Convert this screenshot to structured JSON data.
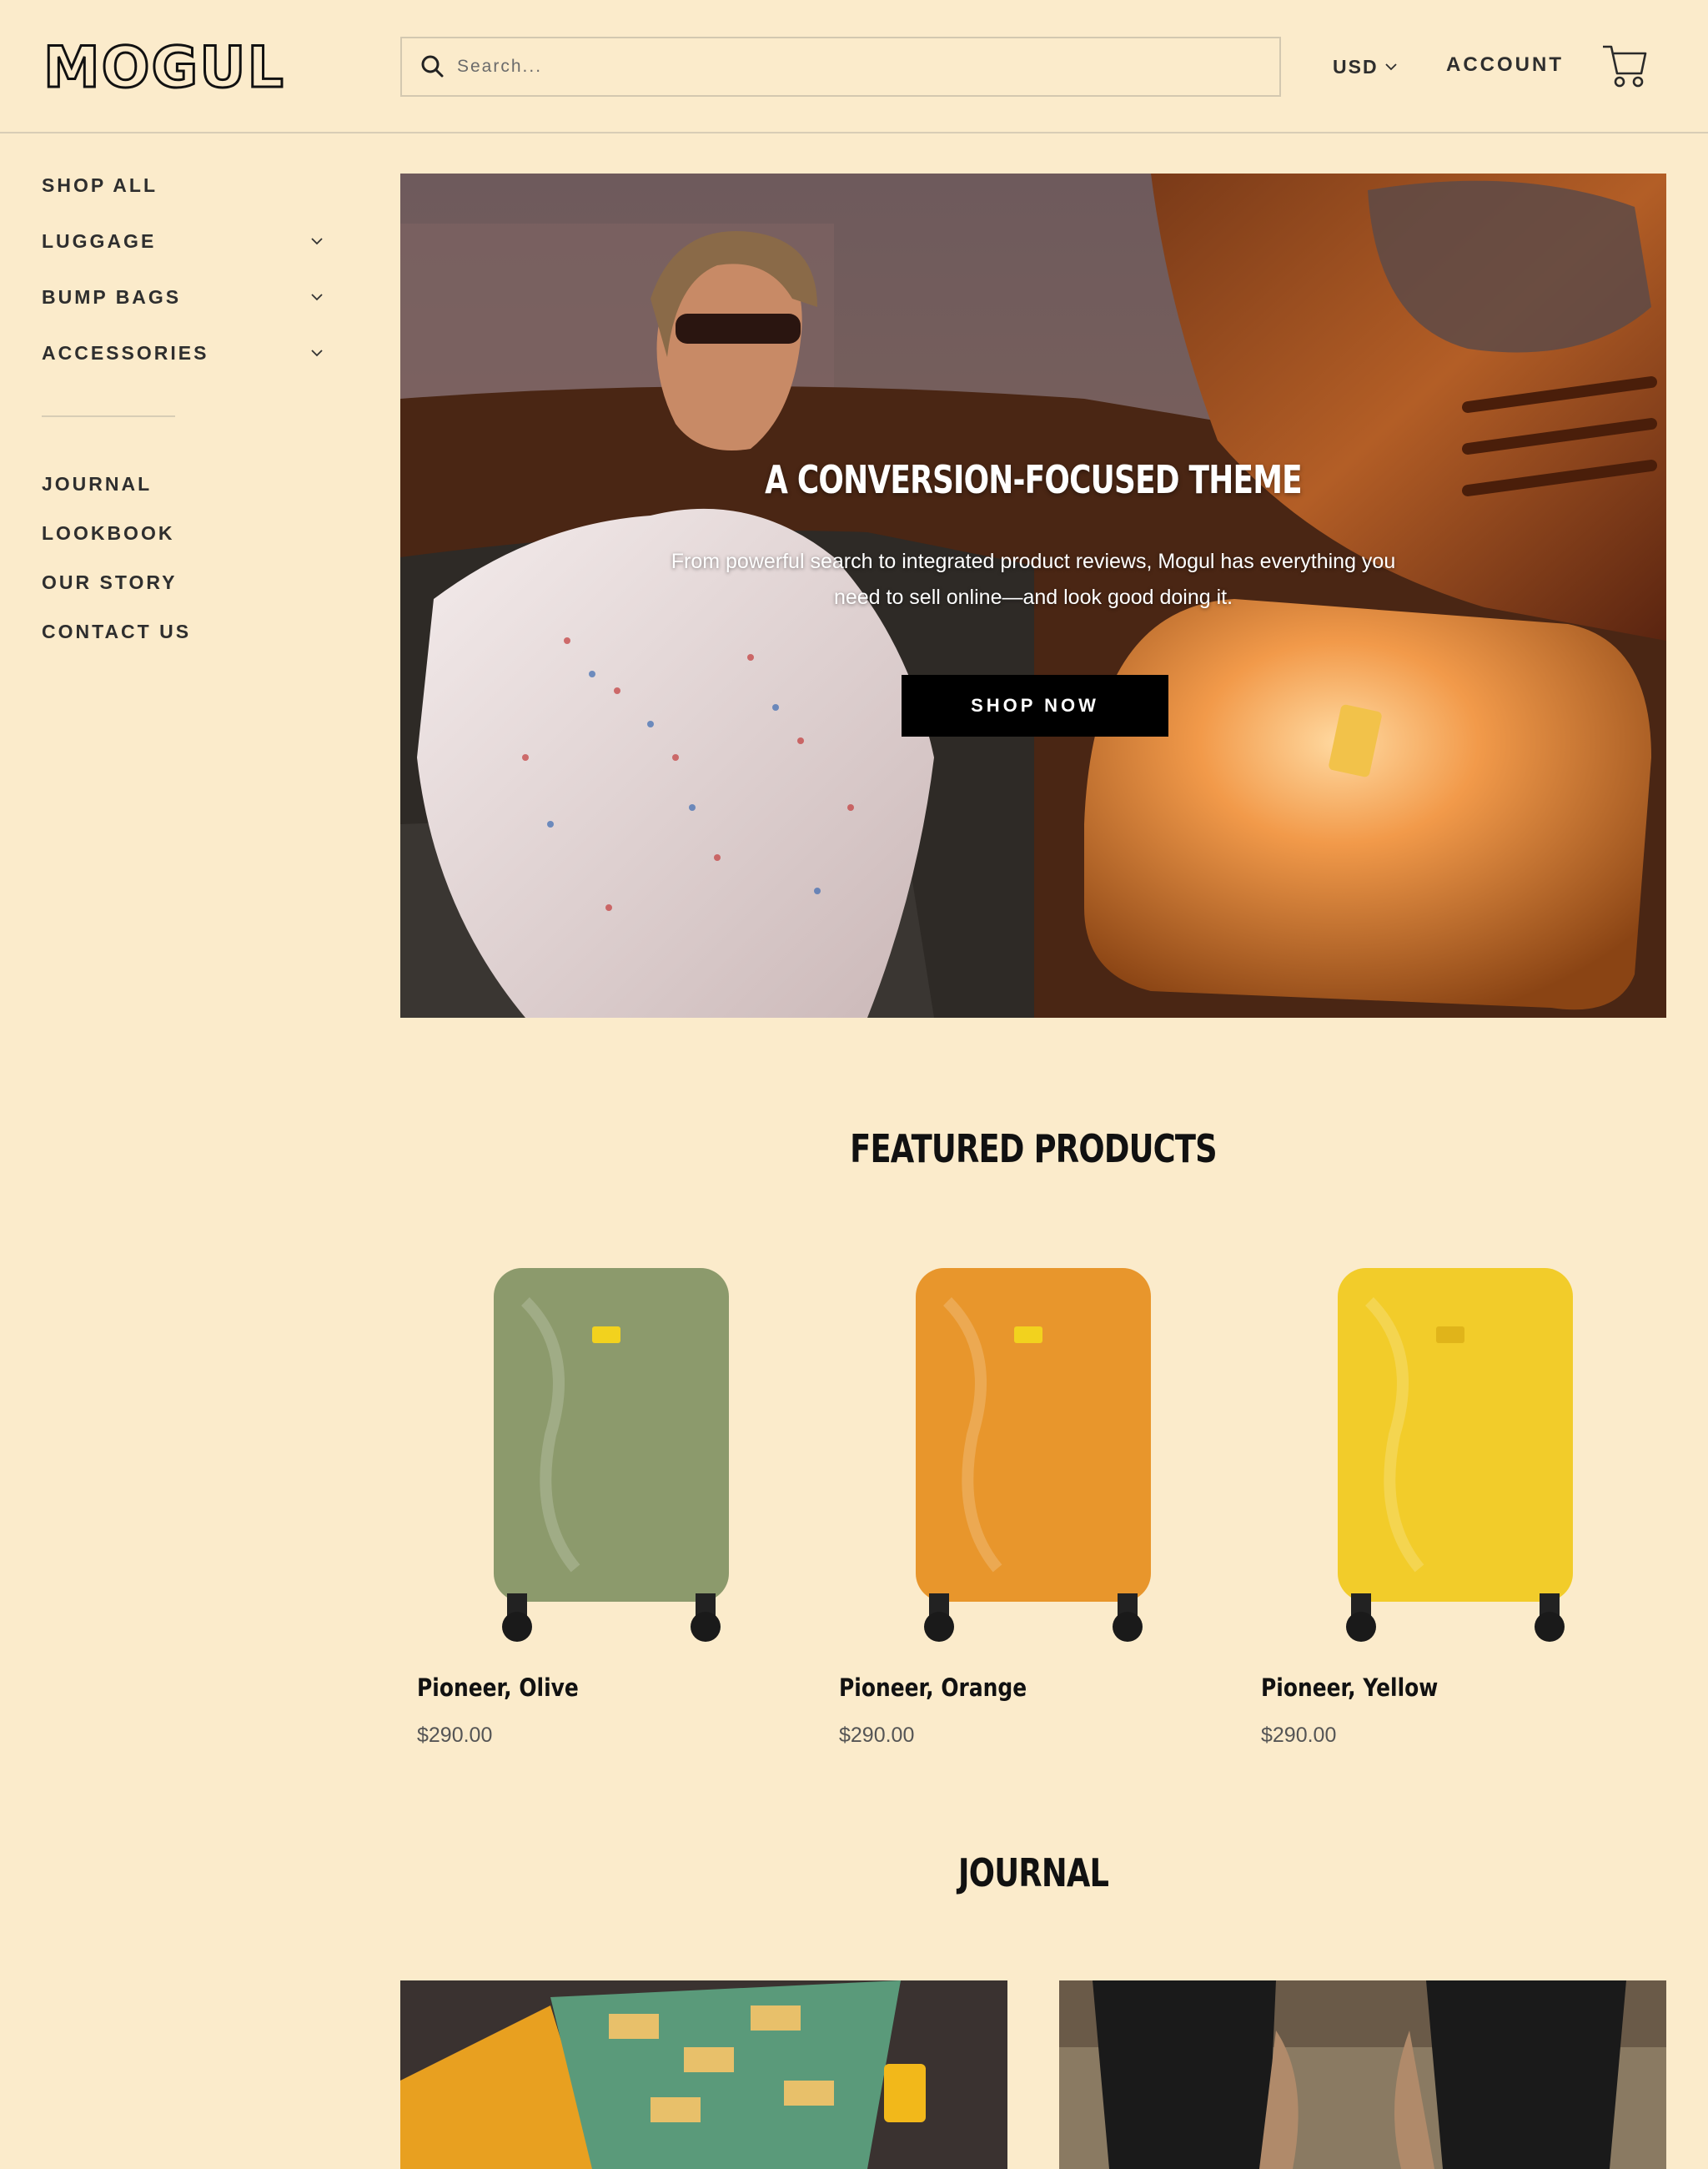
{
  "header": {
    "logo_text": "MOGUL",
    "search_placeholder": "Search...",
    "currency": "USD",
    "account_label": "ACCOUNT"
  },
  "sidebar": {
    "primary": [
      {
        "label": "SHOP ALL",
        "has_dropdown": false
      },
      {
        "label": "LUGGAGE",
        "has_dropdown": true
      },
      {
        "label": "BUMP BAGS",
        "has_dropdown": true
      },
      {
        "label": "ACCESSORIES",
        "has_dropdown": true
      }
    ],
    "secondary": [
      {
        "label": "JOURNAL"
      },
      {
        "label": "LOOKBOOK"
      },
      {
        "label": "OUR STORY"
      },
      {
        "label": "CONTACT US"
      }
    ]
  },
  "hero": {
    "title": "A CONVERSION-FOCUSED THEME",
    "subtitle": "From powerful search to integrated product reviews, Mogul has everything you need to sell online—and look good doing it.",
    "cta_label": "SHOP NOW"
  },
  "featured": {
    "title": "FEATURED PRODUCTS",
    "products": [
      {
        "name": "Pioneer, Olive",
        "price": "$290.00",
        "color": "#8c9a6c"
      },
      {
        "name": "Pioneer, Orange",
        "price": "$290.00",
        "color": "#e8962c"
      },
      {
        "name": "Pioneer, Yellow",
        "price": "$290.00",
        "color": "#f2cc2a"
      }
    ]
  },
  "journal": {
    "title": "JOURNAL"
  },
  "colors": {
    "background": "#fbebcb",
    "button": "#000000",
    "text": "#2e2e2e"
  }
}
